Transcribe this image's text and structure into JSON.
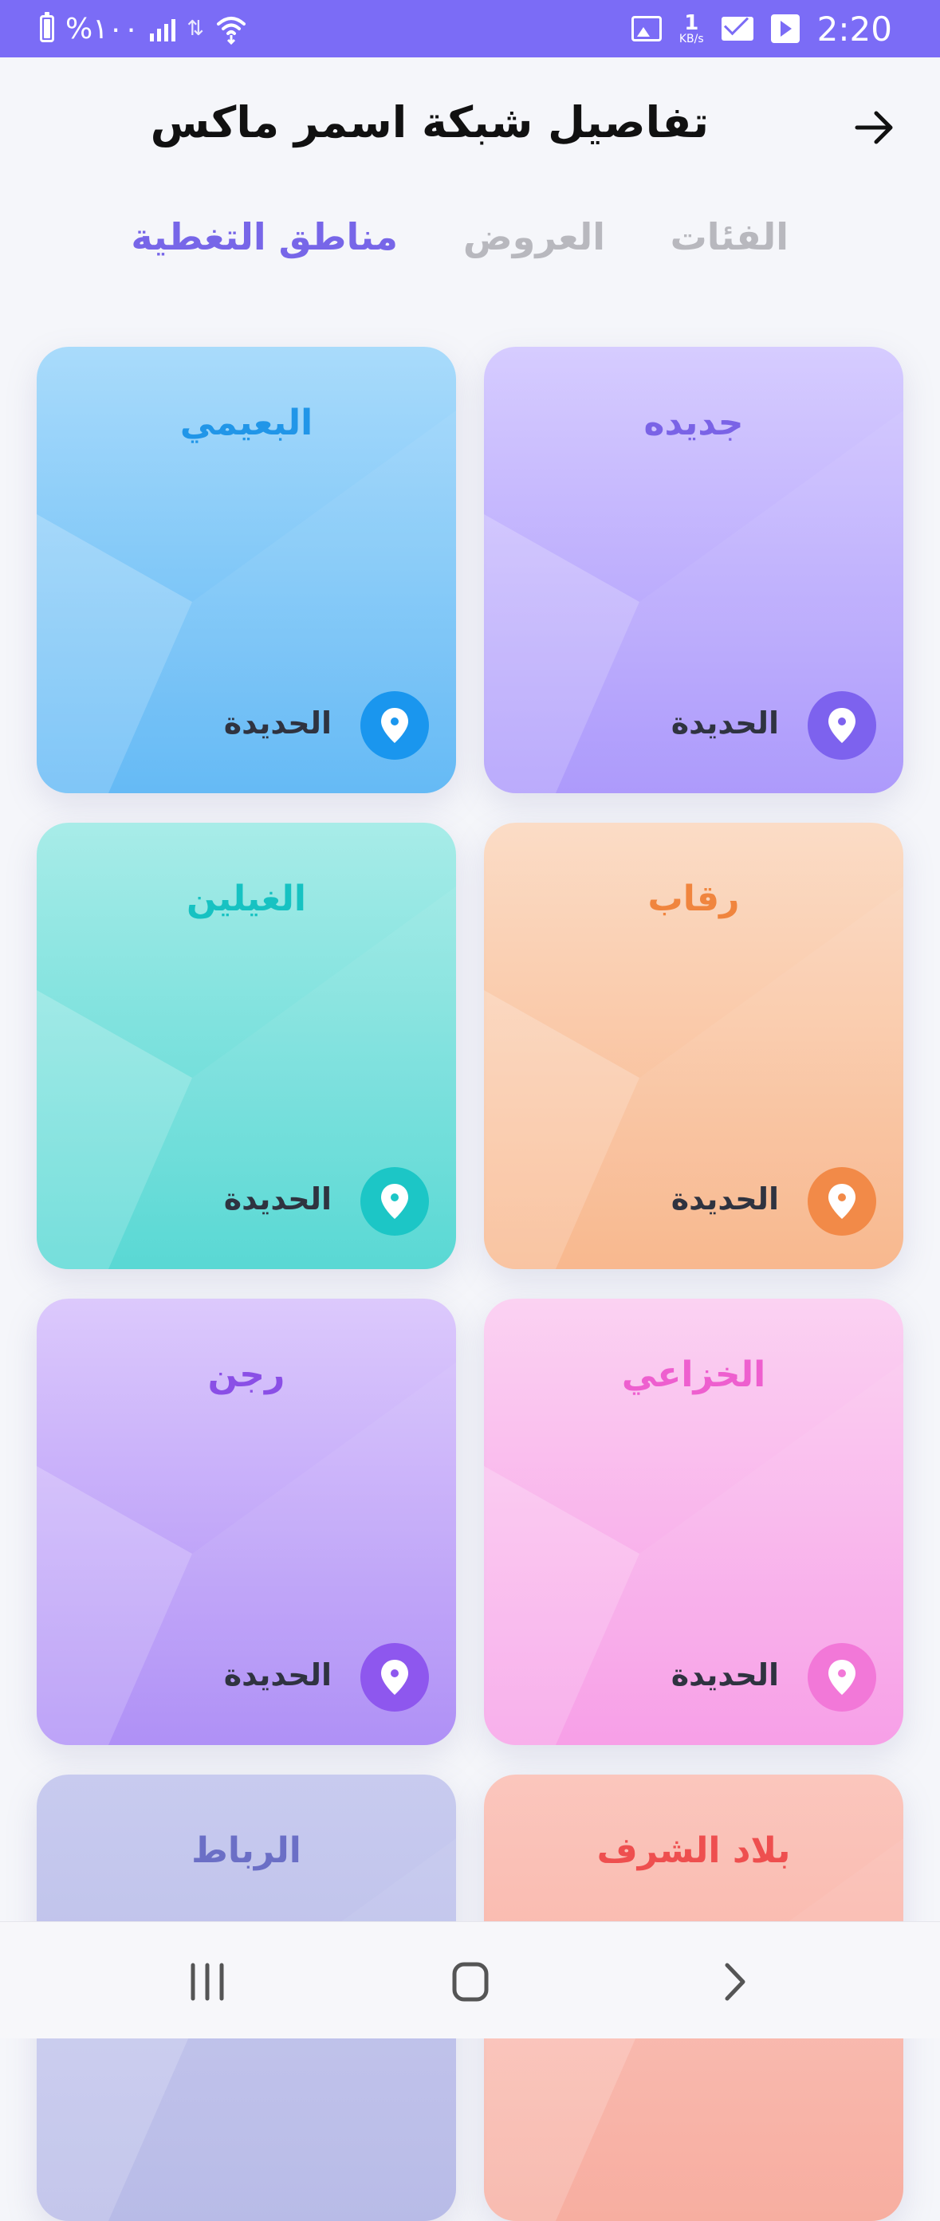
{
  "status_bar": {
    "battery_text": "%١٠٠",
    "data_speed_value": "1",
    "data_speed_unit": "KB/s",
    "time": "2:20"
  },
  "header": {
    "title": "تفاصيل شبكة اسمر ماكس",
    "back_icon": "arrow-right-icon"
  },
  "tabs": [
    {
      "label": "الفئات",
      "active": false
    },
    {
      "label": "العروض",
      "active": false
    },
    {
      "label": "مناطق التغطية",
      "active": true
    }
  ],
  "cards": [
    {
      "name": "جديده",
      "city": "الحديدة",
      "title_color": "#7a63e6",
      "pin_color": "#7d62ee",
      "bg_top": "#d6ccff",
      "bg_bottom": "#a894fb"
    },
    {
      "name": "البعيمي",
      "city": "الحديدة",
      "title_color": "#2196e8",
      "pin_color": "#1a96ee",
      "bg_top": "#a9dbfb",
      "bg_bottom": "#5cb6f5"
    },
    {
      "name": "رقاب",
      "city": "الحديدة",
      "title_color": "#f0853e",
      "pin_color": "#f28a48",
      "bg_top": "#fbdcc6",
      "bg_bottom": "#f8b488"
    },
    {
      "name": "الغيلين",
      "city": "الحديدة",
      "title_color": "#17c2c2",
      "pin_color": "#1cc6c6",
      "bg_top": "#a8ece8",
      "bg_bottom": "#4fd6d2"
    },
    {
      "name": "الخزاعي",
      "city": "الحديدة",
      "title_color": "#ee5fcf",
      "pin_color": "#f278d8",
      "bg_top": "#fbd2f2",
      "bg_bottom": "#f79ae6"
    },
    {
      "name": "رجن",
      "city": "الحديدة",
      "title_color": "#8a4fe6",
      "pin_color": "#8e57ee",
      "bg_top": "#dcc9fc",
      "bg_bottom": "#ab8af6"
    },
    {
      "name": "بلاد الشرف",
      "city": "",
      "title_color": "#ee4f4f",
      "pin_color": "#f07a6a",
      "bg_top": "#fbc6bd",
      "bg_bottom": "#f7a99b"
    },
    {
      "name": "الرباط",
      "city": "",
      "title_color": "#6b6fc6",
      "pin_color": "#7b7fd6",
      "bg_top": "#c8cbef",
      "bg_bottom": "#b4b7e6"
    }
  ],
  "nav": {
    "recent_icon": "recent-apps-icon",
    "home_icon": "home-icon",
    "back_icon": "back-chevron-icon"
  }
}
